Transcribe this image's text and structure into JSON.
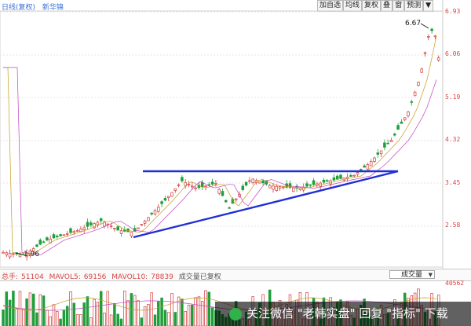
{
  "header": {
    "period": "日线(复权)",
    "stock_name": "新华锦"
  },
  "toolbar": {
    "buttons": [
      "加自选",
      "均线",
      "复权",
      "叠",
      "窗",
      "预测",
      "▼"
    ]
  },
  "price_axis": [
    "6.93",
    "6.06",
    "5.19",
    "4.32",
    "3.45",
    "2.58"
  ],
  "annotations": {
    "high": "6.67",
    "low": "1.96"
  },
  "volume_panel": {
    "total_label": "总手:",
    "total_value": "51104",
    "mavol5_label": "MAVOL5:",
    "mavol5_value": "69156",
    "mavol10_label": "MAVOL10:",
    "mavol10_value": "78839",
    "note": "成交量已复权",
    "selector": "成交量",
    "axis_top": "40562"
  },
  "watermark": {
    "text": "关注微信 \"老韩实盘\" 回复 \"指标\" 下载"
  },
  "colors": {
    "up": "#d23c3c",
    "down": "#1f9e3a",
    "trend": "#1f2fd6",
    "axis_text": "#d64545"
  }
}
